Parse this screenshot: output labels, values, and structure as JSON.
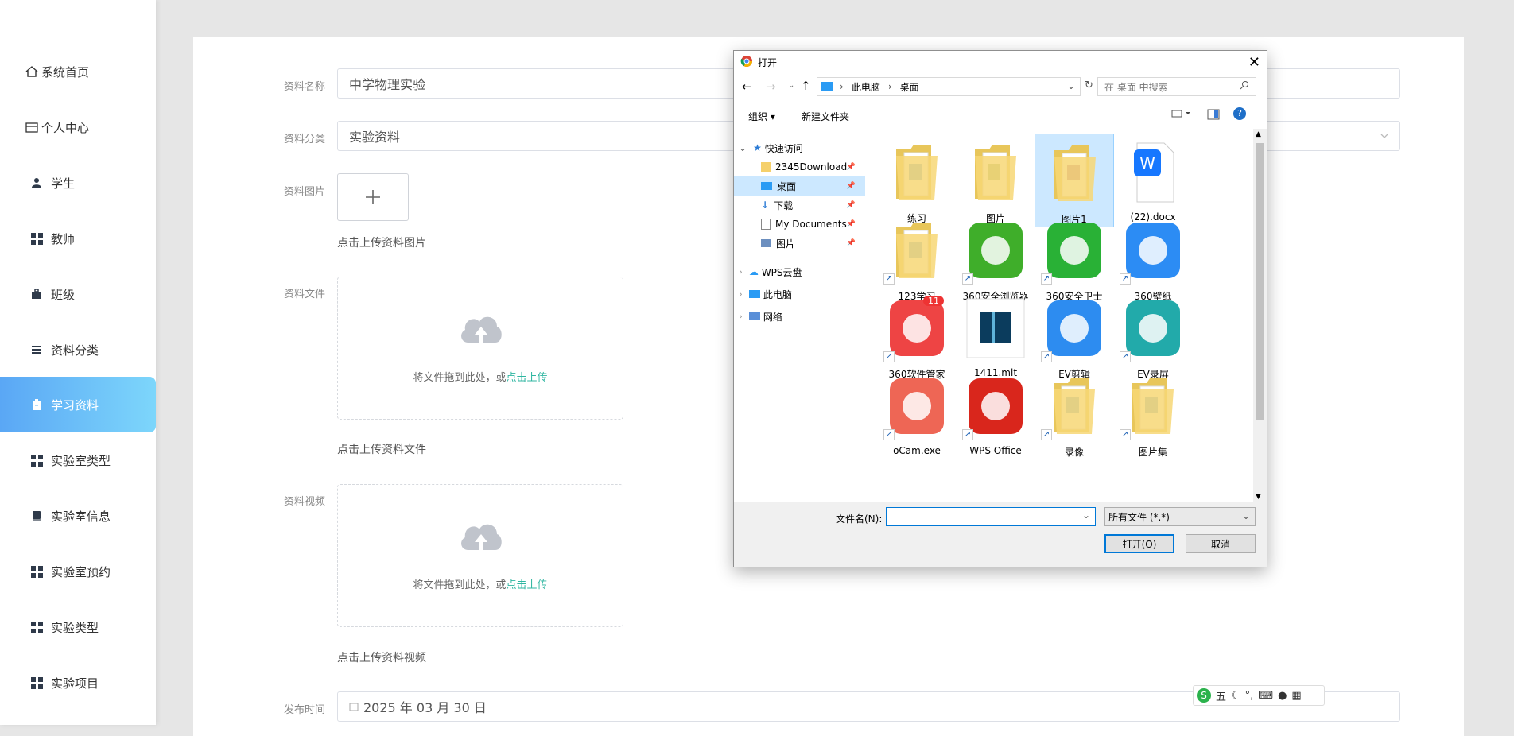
{
  "sidebar": {
    "items": [
      {
        "label": "系统首页",
        "icon": "home-icon"
      },
      {
        "label": "个人中心",
        "icon": "profile-card-icon"
      },
      {
        "label": "学生",
        "icon": "user-icon"
      },
      {
        "label": "教师",
        "icon": "grid-icon"
      },
      {
        "label": "班级",
        "icon": "briefcase-icon"
      },
      {
        "label": "资料分类",
        "icon": "list-icon"
      },
      {
        "label": "学习资料",
        "icon": "clipboard-icon",
        "active": true
      },
      {
        "label": "实验室类型",
        "icon": "grid-icon"
      },
      {
        "label": "实验室信息",
        "icon": "book-icon"
      },
      {
        "label": "实验室预约",
        "icon": "grid-icon"
      },
      {
        "label": "实验类型",
        "icon": "grid-icon"
      },
      {
        "label": "实验项目",
        "icon": "grid-icon"
      }
    ]
  },
  "form": {
    "name_label": "资料名称",
    "name_value": "中学物理实验",
    "category_label": "资料分类",
    "category_value": "实验资料",
    "image_label": "资料图片",
    "image_hint": "点击上传资料图片",
    "file_label": "资料文件",
    "file_drop_text": "将文件拖到此处，或",
    "file_drop_link": "点击上传",
    "file_hint": "点击上传资料文件",
    "video_label": "资料视频",
    "video_drop_text": "将文件拖到此处，或",
    "video_drop_link": "点击上传",
    "video_hint": "点击上传资料视频",
    "time_label": "发布时间",
    "time_value": "2025 年 03 月 30 日"
  },
  "dialog": {
    "title": "打开",
    "path": [
      "此电脑",
      "桌面"
    ],
    "search_placeholder": "在 桌面 中搜索",
    "organize": "组织 ▾",
    "new_folder": "新建文件夹",
    "nav": [
      {
        "label": "快速访问",
        "icon": "star-icon"
      },
      {
        "label": "2345Download",
        "icon": "folder-icon",
        "pinned": true
      },
      {
        "label": "桌面",
        "icon": "desktop-icon",
        "pinned": true,
        "selected": true
      },
      {
        "label": "下载",
        "icon": "download-icon",
        "pinned": true
      },
      {
        "label": "My Documents",
        "icon": "document-icon",
        "pinned": true
      },
      {
        "label": "图片",
        "icon": "image-icon",
        "pinned": true
      },
      {
        "label": "WPS云盘",
        "icon": "cloud-icon"
      },
      {
        "label": "此电脑",
        "icon": "computer-icon"
      },
      {
        "label": "网络",
        "icon": "network-icon"
      }
    ],
    "files": [
      {
        "name": "练习",
        "type": "folder",
        "color": "#3b82c4"
      },
      {
        "name": "图片",
        "type": "folder",
        "color": "#6a8f3a"
      },
      {
        "name": "图片1",
        "type": "folder",
        "color": "#8a3a6a",
        "selected": true
      },
      {
        "name": "(22).docx",
        "type": "wps-doc",
        "color": "#1677ff"
      },
      {
        "name": "123学习",
        "type": "folder",
        "color": "#3b82c4",
        "shortcut": true
      },
      {
        "name": "360安全浏览器",
        "type": "app-360browser",
        "color": "#3fae2a",
        "shortcut": true
      },
      {
        "name": "360安全卫士",
        "type": "app-360safe",
        "color": "#29b136",
        "shortcut": true
      },
      {
        "name": "360壁纸",
        "type": "app-360wallpaper",
        "color": "#2c8cf4",
        "shortcut": true
      },
      {
        "name": "360软件管家",
        "type": "app-360soft",
        "color": "#e44",
        "badge": "11",
        "shortcut": true
      },
      {
        "name": "1411.mlt",
        "type": "mlt-file",
        "color": "#0b3c5d"
      },
      {
        "name": "EV剪辑",
        "type": "app-evedit",
        "color": "#2d8cf0",
        "shortcut": true
      },
      {
        "name": "EV录屏",
        "type": "app-evrecord",
        "color": "#2aa",
        "shortcut": true
      },
      {
        "name": "oCam.exe",
        "type": "app-ocam",
        "color": "#e65",
        "shortcut": true
      },
      {
        "name": "WPS Office",
        "type": "app-wps",
        "color": "#d9261c",
        "shortcut": true
      },
      {
        "name": "录像",
        "type": "folder",
        "color": "#3b82c4",
        "shortcut": true
      },
      {
        "name": "图片集",
        "type": "folder",
        "color": "#3b82c4",
        "shortcut": true
      }
    ],
    "filename_label": "文件名(N):",
    "filename_value": "",
    "filter_value": "所有文件 (*.*)",
    "open_button": "打开(O)",
    "cancel_button": "取消"
  },
  "ime": {
    "label": "五"
  }
}
